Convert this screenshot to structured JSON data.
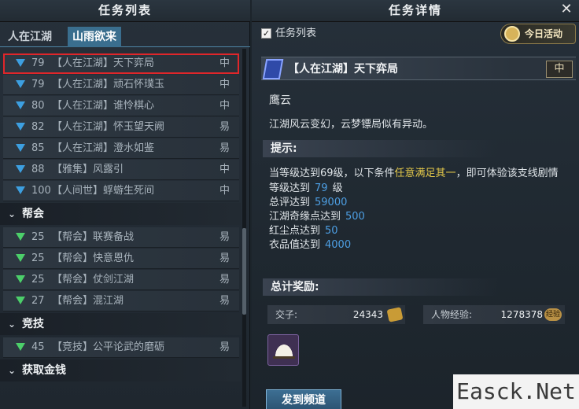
{
  "left_panel": {
    "title": "任务列表",
    "tabs": [
      "人在江湖",
      "山雨欲来"
    ],
    "rows": [
      {
        "level": "79",
        "name": "【人在江湖】天下弈局",
        "difficulty": "中",
        "arrow": "blue",
        "selected": true
      },
      {
        "level": "79",
        "name": "【人在江湖】顽石怀璞玉",
        "difficulty": "中",
        "arrow": "blue"
      },
      {
        "level": "80",
        "name": "【人在江湖】谁怜棋心",
        "difficulty": "中",
        "arrow": "blue"
      },
      {
        "level": "82",
        "name": "【人在江湖】怀玉望天阙",
        "difficulty": "易",
        "arrow": "blue"
      },
      {
        "level": "85",
        "name": "【人在江湖】澄水如鉴",
        "difficulty": "易",
        "arrow": "blue"
      },
      {
        "level": "88",
        "name": "【雅集】风露引",
        "difficulty": "中",
        "arrow": "blue"
      },
      {
        "level": "100",
        "name": "【人间世】蜉蝣生死间",
        "difficulty": "中",
        "arrow": "blue"
      }
    ],
    "groups": [
      {
        "label": "帮会",
        "rows": [
          {
            "level": "25",
            "name": "【帮会】联赛备战",
            "difficulty": "易",
            "arrow": "green"
          },
          {
            "level": "25",
            "name": "【帮会】快意恩仇",
            "difficulty": "易",
            "arrow": "green"
          },
          {
            "level": "25",
            "name": "【帮会】仗剑江湖",
            "difficulty": "易",
            "arrow": "green"
          },
          {
            "level": "27",
            "name": "【帮会】混江湖",
            "difficulty": "易",
            "arrow": "green"
          }
        ]
      },
      {
        "label": "竞技",
        "rows": [
          {
            "level": "45",
            "name": "【竞技】公平论武的磨砺",
            "difficulty": "易",
            "arrow": "green"
          }
        ]
      },
      {
        "label": "获取金钱",
        "rows": []
      }
    ]
  },
  "right_panel": {
    "title": "任务详情",
    "close_glyph": "✕",
    "checkbox_label": "任务列表",
    "checkbox_checked": true,
    "today_button": "今日活动",
    "task_title": "【人在江湖】天下弈局",
    "task_difficulty": "中",
    "npc": "鹰云",
    "description": "江湖风云变幻，云梦镖局似有异动。",
    "hint_title": "提示:",
    "hint_intro_a": "当等级达到69级，以下条件",
    "hint_intro_em": "任意满足其一",
    "hint_intro_b": "，即可体验该支线剧情",
    "conditions": [
      {
        "label": "等级达到",
        "value": "79",
        "unit": "级"
      },
      {
        "label": "总评达到",
        "value": "59000",
        "unit": ""
      },
      {
        "label": "江湖奇缘点达到",
        "value": "500",
        "unit": ""
      },
      {
        "label": "红尘点达到",
        "value": "50",
        "unit": ""
      },
      {
        "label": "衣品值达到",
        "value": "4000",
        "unit": ""
      }
    ],
    "reward_title": "总计奖励:",
    "rewards": [
      {
        "label": "交子:",
        "value": "24343",
        "icon": "coin-icon"
      },
      {
        "label": "人物经验:",
        "value": "1278378",
        "icon": "exp-icon",
        "icon_text": "经验"
      }
    ],
    "item_icon": "fan-icon",
    "share_button": "发到频道"
  },
  "watermark": "Easck.Net",
  "colors": {
    "blue_value": "#4d9fe4",
    "highlight": "#e4c84a",
    "selected_outline": "#e0262a",
    "blue_arrow": "#3d9fe0",
    "green_arrow": "#4ccf6a"
  }
}
